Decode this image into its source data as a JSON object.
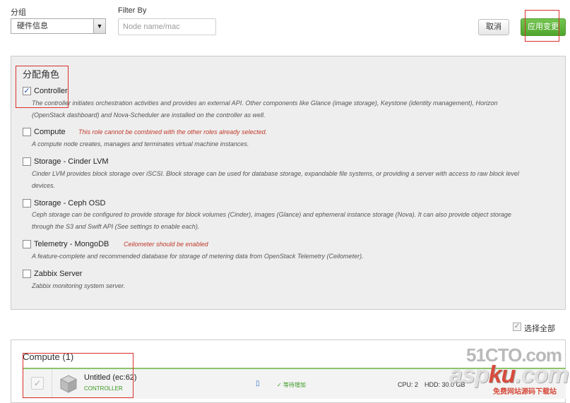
{
  "toolbar": {
    "group_label": "分组",
    "group_value": "硬件信息",
    "filter_label": "Filter By",
    "filter_placeholder": "Node name/mac",
    "cancel_label": "取消",
    "apply_label": "应用变更"
  },
  "roles_panel": {
    "title": "分配角色",
    "roles": [
      {
        "name": "Controller",
        "checked": true,
        "warning": "",
        "desc1": "The controller initiates orchestration activities and provides an external API. Other components like Glance (image storage), Keystone (identity management), Horizon",
        "desc2": "(OpenStack dashboard) and Nova-Scheduler are installed on the controller as well."
      },
      {
        "name": "Compute",
        "checked": false,
        "warning": "This role cannot be combined with the other roles already selected.",
        "desc1": "A compute node creates, manages and terminates virtual machine instances.",
        "desc2": ""
      },
      {
        "name": "Storage - Cinder LVM",
        "checked": false,
        "warning": "",
        "desc1": "Cinder LVM provides block storage over iSCSI. Block storage can be used for database storage, expandable file systems, or providing a server with access to raw block level",
        "desc2": "devices."
      },
      {
        "name": "Storage - Ceph OSD",
        "checked": false,
        "warning": "",
        "desc1": "Ceph storage can be configured to provide storage for block volumes (Cinder), images (Glance) and ephemeral instance storage (Nova). It can also provide object storage",
        "desc2": "through the S3 and Swift API (See settings to enable each)."
      },
      {
        "name": "Telemetry - MongoDB",
        "checked": false,
        "warning": "Ceilometer should be enabled",
        "desc1": "A feature-complete and recommended database for storage of metering data from OpenStack Telemetry (Ceilometer).",
        "desc2": ""
      },
      {
        "name": "Zabbix Server",
        "checked": false,
        "warning": "",
        "desc1": "Zabbix monitoring system server.",
        "desc2": ""
      }
    ]
  },
  "select_all": {
    "label": "选择全部"
  },
  "node_group": {
    "title": "Compute (1)",
    "node": {
      "name": "Untitled (ec:62)",
      "role": "CONTROLLER",
      "status": "等待增加",
      "cpu": "CPU: 2",
      "hdd": "HDD: 30.0 GB"
    }
  },
  "watermark": {
    "line1": "51CTO.com",
    "line2_a": "asp",
    "line2_b": "ku",
    "line2_c": ".com",
    "line3": "免费网站源码下载站"
  }
}
